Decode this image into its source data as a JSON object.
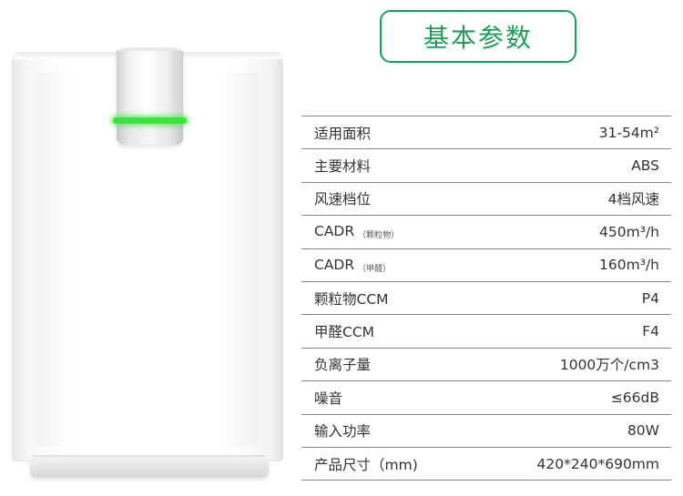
{
  "title": "基本参数",
  "product": {
    "indicator_color": "#3ee23e"
  },
  "specs": [
    {
      "label": "适用面积",
      "sub": "",
      "value": "31-54m²"
    },
    {
      "label": "主要材料",
      "sub": "",
      "value": "ABS"
    },
    {
      "label": "风速档位",
      "sub": "",
      "value": "4档风速"
    },
    {
      "label": "CADR",
      "sub": "（颗粒物）",
      "value": "450m³/h"
    },
    {
      "label": "CADR",
      "sub": "（甲醛）",
      "value": "160m³/h"
    },
    {
      "label": "颗粒物CCM",
      "sub": "",
      "value": "P4"
    },
    {
      "label": "甲醛CCM",
      "sub": "",
      "value": "F4"
    },
    {
      "label": "负离子量",
      "sub": "",
      "value": "1000万个/cm3"
    },
    {
      "label": "噪音",
      "sub": "",
      "value": "≤66dB"
    },
    {
      "label": "输入功率",
      "sub": "",
      "value": "80W"
    },
    {
      "label": "产品尺寸（mm)",
      "sub": "",
      "value": "420*240*690mm"
    }
  ],
  "colors": {
    "accent": "#1f9d5a",
    "rule": "#888888",
    "text": "#333333"
  }
}
